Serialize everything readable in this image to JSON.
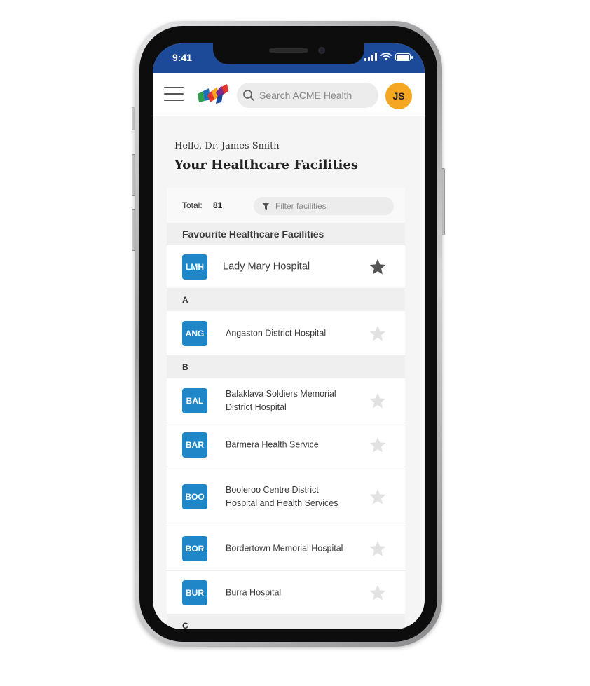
{
  "status_bar": {
    "time": "9:41"
  },
  "header": {
    "search_placeholder": "Search ACME Health",
    "avatar_initials": "JS",
    "brand_color": "#1c4a98",
    "avatar_color": "#f5a623"
  },
  "greeting": "Hello, Dr. James Smith",
  "page_title": "Your Healthcare Facilities",
  "summary": {
    "total_label": "Total:",
    "total_value": "81",
    "filter_placeholder": "Filter facilities"
  },
  "favourites": {
    "header": "Favourite Healthcare Facilities",
    "items": [
      {
        "code": "LMH",
        "name": "Lady Mary Hospital",
        "favourite": true
      }
    ]
  },
  "sections": [
    {
      "letter": "A",
      "items": [
        {
          "code": "ANG",
          "name": "Angaston District Hospital",
          "favourite": false
        }
      ]
    },
    {
      "letter": "B",
      "items": [
        {
          "code": "BAL",
          "name": "Balaklava Soldiers Memorial District Hospital",
          "favourite": false
        },
        {
          "code": "BAR",
          "name": "Barmera Health Service",
          "favourite": false
        },
        {
          "code": "BOO",
          "name": "Booleroo Centre District Hospital and Health Services",
          "favourite": false
        },
        {
          "code": "BOR",
          "name": "Bordertown Memorial Hospital",
          "favourite": false
        },
        {
          "code": "BUR",
          "name": "Burra Hospital",
          "favourite": false
        }
      ]
    },
    {
      "letter": "C",
      "items": []
    }
  ],
  "colors": {
    "badge": "#1f86c8",
    "star_on": "#555555",
    "star_off": "#e2e2e2"
  },
  "icons": [
    "menu-icon",
    "acme-logo-icon",
    "search-icon",
    "filter-icon",
    "star-icon"
  ]
}
